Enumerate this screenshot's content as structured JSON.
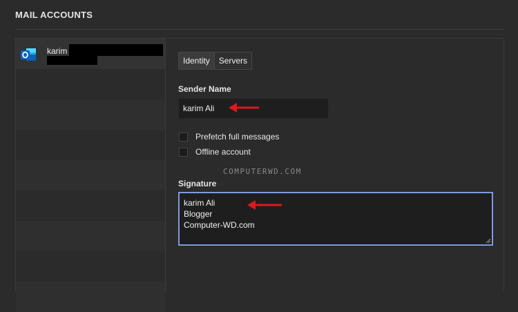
{
  "header": {
    "title": "MAIL ACCOUNTS"
  },
  "accounts": [
    {
      "name": "karim",
      "icon": "outlook-icon"
    }
  ],
  "tabs": [
    {
      "label": "Identity",
      "active": true
    },
    {
      "label": "Servers",
      "active": false
    }
  ],
  "identity": {
    "sender_label": "Sender Name",
    "sender_value": "karim Ali",
    "prefetch_label": "Prefetch full messages",
    "offline_label": "Offline account",
    "signature_label": "Signature",
    "signature_lines": [
      "karim Ali",
      "Blogger",
      "Computer-WD.com"
    ]
  },
  "watermark": "COMPUTERWD.COM",
  "colors": {
    "background": "#2b2b2b",
    "input_bg": "#1e1e1e",
    "focus_border": "#7c9be0",
    "arrow": "#e0161b",
    "outlook_blue": "#0a64c8"
  }
}
